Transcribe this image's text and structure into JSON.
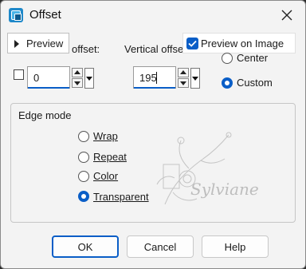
{
  "window": {
    "title": "Offset"
  },
  "preview_tab": {
    "label": "Preview"
  },
  "preview_on_image": {
    "label": "Preview on Image",
    "checked": true
  },
  "horizontal_offset": {
    "label": "offset:",
    "value": "0"
  },
  "vertical_offset": {
    "label": "Vertical offse",
    "value": "195"
  },
  "offset_mode": {
    "options": [
      "Center",
      "Custom"
    ],
    "selected": "Custom"
  },
  "edge_mode": {
    "title": "Edge mode",
    "options": [
      "Wrap",
      "Repeat",
      "Color",
      "Transparent"
    ],
    "selected": "Transparent"
  },
  "watermark": {
    "text": "Sylviane"
  },
  "buttons": {
    "ok": "OK",
    "cancel": "Cancel",
    "help": "Help"
  },
  "colors": {
    "accent": "#0a5ec7",
    "background": "#f3f3f3"
  }
}
